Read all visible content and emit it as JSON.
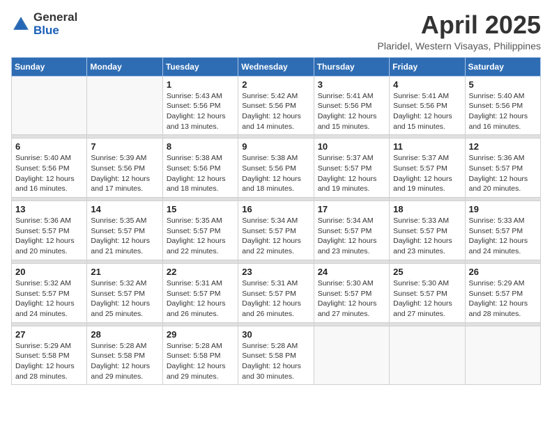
{
  "logo": {
    "text_general": "General",
    "text_blue": "Blue"
  },
  "header": {
    "month_title": "April 2025",
    "subtitle": "Plaridel, Western Visayas, Philippines"
  },
  "weekdays": [
    "Sunday",
    "Monday",
    "Tuesday",
    "Wednesday",
    "Thursday",
    "Friday",
    "Saturday"
  ],
  "weeks": [
    [
      {
        "day": "",
        "empty": true
      },
      {
        "day": "",
        "empty": true
      },
      {
        "day": "1",
        "sunrise": "Sunrise: 5:43 AM",
        "sunset": "Sunset: 5:56 PM",
        "daylight": "Daylight: 12 hours and 13 minutes."
      },
      {
        "day": "2",
        "sunrise": "Sunrise: 5:42 AM",
        "sunset": "Sunset: 5:56 PM",
        "daylight": "Daylight: 12 hours and 14 minutes."
      },
      {
        "day": "3",
        "sunrise": "Sunrise: 5:41 AM",
        "sunset": "Sunset: 5:56 PM",
        "daylight": "Daylight: 12 hours and 15 minutes."
      },
      {
        "day": "4",
        "sunrise": "Sunrise: 5:41 AM",
        "sunset": "Sunset: 5:56 PM",
        "daylight": "Daylight: 12 hours and 15 minutes."
      },
      {
        "day": "5",
        "sunrise": "Sunrise: 5:40 AM",
        "sunset": "Sunset: 5:56 PM",
        "daylight": "Daylight: 12 hours and 16 minutes."
      }
    ],
    [
      {
        "day": "6",
        "sunrise": "Sunrise: 5:40 AM",
        "sunset": "Sunset: 5:56 PM",
        "daylight": "Daylight: 12 hours and 16 minutes."
      },
      {
        "day": "7",
        "sunrise": "Sunrise: 5:39 AM",
        "sunset": "Sunset: 5:56 PM",
        "daylight": "Daylight: 12 hours and 17 minutes."
      },
      {
        "day": "8",
        "sunrise": "Sunrise: 5:38 AM",
        "sunset": "Sunset: 5:56 PM",
        "daylight": "Daylight: 12 hours and 18 minutes."
      },
      {
        "day": "9",
        "sunrise": "Sunrise: 5:38 AM",
        "sunset": "Sunset: 5:56 PM",
        "daylight": "Daylight: 12 hours and 18 minutes."
      },
      {
        "day": "10",
        "sunrise": "Sunrise: 5:37 AM",
        "sunset": "Sunset: 5:57 PM",
        "daylight": "Daylight: 12 hours and 19 minutes."
      },
      {
        "day": "11",
        "sunrise": "Sunrise: 5:37 AM",
        "sunset": "Sunset: 5:57 PM",
        "daylight": "Daylight: 12 hours and 19 minutes."
      },
      {
        "day": "12",
        "sunrise": "Sunrise: 5:36 AM",
        "sunset": "Sunset: 5:57 PM",
        "daylight": "Daylight: 12 hours and 20 minutes."
      }
    ],
    [
      {
        "day": "13",
        "sunrise": "Sunrise: 5:36 AM",
        "sunset": "Sunset: 5:57 PM",
        "daylight": "Daylight: 12 hours and 20 minutes."
      },
      {
        "day": "14",
        "sunrise": "Sunrise: 5:35 AM",
        "sunset": "Sunset: 5:57 PM",
        "daylight": "Daylight: 12 hours and 21 minutes."
      },
      {
        "day": "15",
        "sunrise": "Sunrise: 5:35 AM",
        "sunset": "Sunset: 5:57 PM",
        "daylight": "Daylight: 12 hours and 22 minutes."
      },
      {
        "day": "16",
        "sunrise": "Sunrise: 5:34 AM",
        "sunset": "Sunset: 5:57 PM",
        "daylight": "Daylight: 12 hours and 22 minutes."
      },
      {
        "day": "17",
        "sunrise": "Sunrise: 5:34 AM",
        "sunset": "Sunset: 5:57 PM",
        "daylight": "Daylight: 12 hours and 23 minutes."
      },
      {
        "day": "18",
        "sunrise": "Sunrise: 5:33 AM",
        "sunset": "Sunset: 5:57 PM",
        "daylight": "Daylight: 12 hours and 23 minutes."
      },
      {
        "day": "19",
        "sunrise": "Sunrise: 5:33 AM",
        "sunset": "Sunset: 5:57 PM",
        "daylight": "Daylight: 12 hours and 24 minutes."
      }
    ],
    [
      {
        "day": "20",
        "sunrise": "Sunrise: 5:32 AM",
        "sunset": "Sunset: 5:57 PM",
        "daylight": "Daylight: 12 hours and 24 minutes."
      },
      {
        "day": "21",
        "sunrise": "Sunrise: 5:32 AM",
        "sunset": "Sunset: 5:57 PM",
        "daylight": "Daylight: 12 hours and 25 minutes."
      },
      {
        "day": "22",
        "sunrise": "Sunrise: 5:31 AM",
        "sunset": "Sunset: 5:57 PM",
        "daylight": "Daylight: 12 hours and 26 minutes."
      },
      {
        "day": "23",
        "sunrise": "Sunrise: 5:31 AM",
        "sunset": "Sunset: 5:57 PM",
        "daylight": "Daylight: 12 hours and 26 minutes."
      },
      {
        "day": "24",
        "sunrise": "Sunrise: 5:30 AM",
        "sunset": "Sunset: 5:57 PM",
        "daylight": "Daylight: 12 hours and 27 minutes."
      },
      {
        "day": "25",
        "sunrise": "Sunrise: 5:30 AM",
        "sunset": "Sunset: 5:57 PM",
        "daylight": "Daylight: 12 hours and 27 minutes."
      },
      {
        "day": "26",
        "sunrise": "Sunrise: 5:29 AM",
        "sunset": "Sunset: 5:57 PM",
        "daylight": "Daylight: 12 hours and 28 minutes."
      }
    ],
    [
      {
        "day": "27",
        "sunrise": "Sunrise: 5:29 AM",
        "sunset": "Sunset: 5:58 PM",
        "daylight": "Daylight: 12 hours and 28 minutes."
      },
      {
        "day": "28",
        "sunrise": "Sunrise: 5:28 AM",
        "sunset": "Sunset: 5:58 PM",
        "daylight": "Daylight: 12 hours and 29 minutes."
      },
      {
        "day": "29",
        "sunrise": "Sunrise: 5:28 AM",
        "sunset": "Sunset: 5:58 PM",
        "daylight": "Daylight: 12 hours and 29 minutes."
      },
      {
        "day": "30",
        "sunrise": "Sunrise: 5:28 AM",
        "sunset": "Sunset: 5:58 PM",
        "daylight": "Daylight: 12 hours and 30 minutes."
      },
      {
        "day": "",
        "empty": true
      },
      {
        "day": "",
        "empty": true
      },
      {
        "day": "",
        "empty": true
      }
    ]
  ]
}
